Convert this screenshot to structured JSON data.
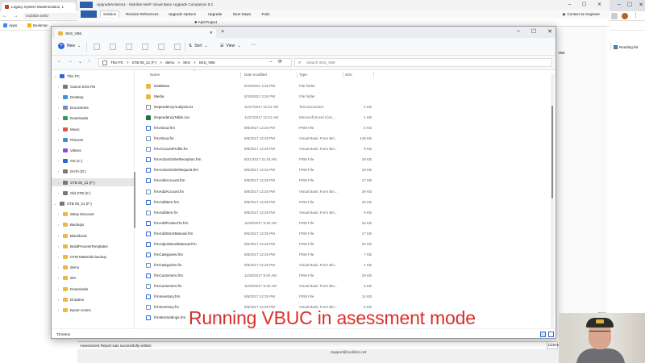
{
  "browser": {
    "tab_title": "Legacy System Modernization, L",
    "url": "mobilize.net/d",
    "bookmarks": [
      {
        "label": "Apps"
      },
      {
        "label": "Bookmar"
      }
    ],
    "reading_list": "Reading list"
  },
  "app": {
    "title": "UpgradeSolution1 - Mobilize.Net® Visual Basic Upgrade Companion 9.2",
    "ribbon_tabs": [
      "Solution",
      "Resolve References",
      "Upgrade Options",
      "Upgrade",
      "Next Steps",
      "Tools"
    ],
    "contact": "Contact an engineer",
    "add_project": "Add Project",
    "right_label": "VB6",
    "right_note": "ience to",
    "status": "Assessment Report was successfully written.",
    "status_right": "Licens",
    "bottom_text": "Support@mobilize.net"
  },
  "explorer": {
    "tab_title": "SKS_VB6",
    "toolbar": {
      "new_label": "New",
      "sort_label": "Sort",
      "view_label": "View",
      "more_label": "···"
    },
    "breadcrumbs": [
      "This PC",
      ">",
      "STB 05_21 (F:)",
      ">",
      "demo",
      ">",
      "SKS",
      ">",
      "SKS_VB6"
    ],
    "search_placeholder": "Search SKS_VB6",
    "tree": [
      {
        "label": "This PC",
        "color": "#2b66d9",
        "expanded": true,
        "indent": 0
      },
      {
        "label": "Canon EOS R5",
        "color": "#777777",
        "indent": 1
      },
      {
        "label": "Desktop",
        "color": "#3a8fd9",
        "indent": 1
      },
      {
        "label": "Documents",
        "color": "#6d8fb5",
        "indent": 1
      },
      {
        "label": "Downloads",
        "color": "#2e9a57",
        "indent": 1
      },
      {
        "label": "Music",
        "color": "#d9534f",
        "indent": 1
      },
      {
        "label": "Pictures",
        "color": "#3a8fd9",
        "indent": 1
      },
      {
        "label": "Videos",
        "color": "#8a4fd9",
        "indent": 1
      },
      {
        "label": "OS (C:)",
        "color": "#2b66d9",
        "indent": 1
      },
      {
        "label": "DATA (D:)",
        "color": "#777777",
        "indent": 1
      },
      {
        "label": "STB 05_21 (F:)",
        "color": "#777777",
        "indent": 1,
        "selected": true
      },
      {
        "label": "Old STB (K:)",
        "color": "#777777",
        "indent": 1
      },
      {
        "label": "STB 05_21 (F:)",
        "color": "#777777",
        "expanded": true,
        "indent": 0
      },
      {
        "label": "SDay Discount",
        "color": "#e8b84a",
        "indent": 1
      },
      {
        "label": "Backups",
        "color": "#e8b84a",
        "indent": 1
      },
      {
        "label": "Blackbook",
        "color": "#e8b84a",
        "indent": 1
      },
      {
        "label": "BuildProcessTemplates",
        "color": "#e8b84a",
        "indent": 1
      },
      {
        "label": "CFM Materials backup",
        "color": "#e8b84a",
        "indent": 1
      },
      {
        "label": "demo",
        "color": "#e8b84a",
        "indent": 1
      },
      {
        "label": "dev",
        "color": "#e8b84a",
        "indent": 1
      },
      {
        "label": "Downloads",
        "color": "#e8b84a",
        "indent": 1
      },
      {
        "label": "Dropbox",
        "color": "#e8b84a",
        "indent": 1
      },
      {
        "label": "Epson scans",
        "color": "#e8b84a",
        "indent": 1
      }
    ],
    "columns": {
      "name": "Name",
      "date": "Date modified",
      "type": "Type",
      "size": "Size"
    },
    "files": [
      {
        "name": "Database",
        "date": "5/18/2021 3:26 PM",
        "type": "File folder",
        "size": "",
        "kind": "folder"
      },
      {
        "name": "Media",
        "date": "5/18/2021 3:26 PM",
        "type": "File folder",
        "size": "",
        "kind": "folder"
      },
      {
        "name": "DependencyAnalysis.txt",
        "date": "11/27/2017 11:01 AM",
        "type": "Text Document",
        "size": "2 KB",
        "kind": "txt"
      },
      {
        "name": "DependencyTable.csv",
        "date": "11/27/2017 11:01 AM",
        "type": "Microsoft Excel Com...",
        "size": "1 KB",
        "kind": "xls"
      },
      {
        "name": "frmAbout.frm",
        "date": "8/8/2017 12:25 PM",
        "type": "FRM File",
        "size": "5 KB",
        "kind": "frm"
      },
      {
        "name": "frmAbout.frx",
        "date": "8/8/2017 12:25 PM",
        "type": "Visual Basic Form Bin...",
        "size": "149 KB",
        "kind": "frx"
      },
      {
        "name": "frmAccountProfile.frx",
        "date": "8/8/2017 12:25 PM",
        "type": "Visual Basic Form Bin...",
        "size": "9 KB",
        "kind": "frx"
      },
      {
        "name": "frmActionOrderReception.frm",
        "date": "8/31/2017 11:43 AM",
        "type": "FRM File",
        "size": "18 KB",
        "kind": "frm"
      },
      {
        "name": "frmActionOrderRequest.frm",
        "date": "9/5/2017 12:34 PM",
        "type": "FRM File",
        "size": "18 KB",
        "kind": "frm"
      },
      {
        "name": "frmAddAccount.frm",
        "date": "8/8/2017 12:25 PM",
        "type": "FRM File",
        "size": "17 KB",
        "kind": "frm"
      },
      {
        "name": "frmAddAccount.frx",
        "date": "8/8/2017 12:25 PM",
        "type": "Visual Basic Form Bin...",
        "size": "29 KB",
        "kind": "frx"
      },
      {
        "name": "frmAddItem.frm",
        "date": "8/8/2017 12:25 PM",
        "type": "FRM File",
        "size": "40 KB",
        "kind": "frm"
      },
      {
        "name": "frmAddItem.frx",
        "date": "8/8/2017 12:25 PM",
        "type": "Visual Basic Form Bin...",
        "size": "6 KB",
        "kind": "frx"
      },
      {
        "name": "frmAddProductTo.frm",
        "date": "11/20/2017 9:40 AM",
        "type": "FRM File",
        "size": "15 KB",
        "kind": "frm"
      },
      {
        "name": "frmAddStockManual.frm",
        "date": "9/5/2017 12:35 PM",
        "type": "FRM File",
        "size": "17 KB",
        "kind": "frm"
      },
      {
        "name": "frmAdjustStockManual.frm",
        "date": "9/5/2017 12:40 PM",
        "type": "FRM File",
        "size": "22 KB",
        "kind": "frm"
      },
      {
        "name": "frmCategories.frm",
        "date": "8/8/2017 12:25 PM",
        "type": "FRM File",
        "size": "7 KB",
        "kind": "frm"
      },
      {
        "name": "frmCategories.frx",
        "date": "8/8/2017 12:25 PM",
        "type": "Visual Basic Form Bin...",
        "size": "1 KB",
        "kind": "frx"
      },
      {
        "name": "frmCustomers.frm",
        "date": "11/20/2017 9:40 AM",
        "type": "FRM File",
        "size": "18 KB",
        "kind": "frm"
      },
      {
        "name": "frmCustomers.frx",
        "date": "11/20/2017 9:40 AM",
        "type": "Visual Basic Form Bin...",
        "size": "5 KB",
        "kind": "frx"
      },
      {
        "name": "frmInventory.frm",
        "date": "8/8/2017 12:25 PM",
        "type": "FRM File",
        "size": "14 KB",
        "kind": "frm"
      },
      {
        "name": "frmInventory.frx",
        "date": "8/8/2017 12:25 PM",
        "type": "Visual Basic Form Bin...",
        "size": "5 KB",
        "kind": "frx"
      },
      {
        "name": "frmItemSettings.frm",
        "date": "",
        "type": "",
        "size": "",
        "kind": "frm"
      }
    ],
    "status_count": "78 items"
  },
  "caption": "Running VBUC in asessment mode"
}
